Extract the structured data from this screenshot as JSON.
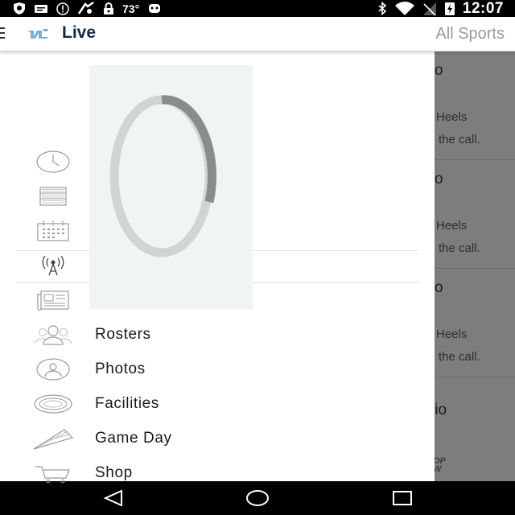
{
  "status_bar": {
    "temperature": "73°",
    "time": "12:07",
    "icons": [
      "shield-icon",
      "message-icon",
      "alert-circle-icon",
      "fan-icon",
      "lock-icon",
      "temperature",
      "android-icon",
      "bluetooth-icon",
      "wifi-icon",
      "signal-icon",
      "battery-icon",
      "time"
    ]
  },
  "app_bar": {
    "title": "Live",
    "right_label": "All Sports",
    "logo_icon": "unc-logo-icon",
    "brand_color": "#13294b"
  },
  "drawer": {
    "items": [
      {
        "icon": "clock-icon",
        "label": ""
      },
      {
        "icon": "list-icon",
        "label": ""
      },
      {
        "icon": "calendar-icon",
        "label": ""
      },
      {
        "icon": "broadcast-icon",
        "label": ""
      },
      {
        "icon": "news-icon",
        "label": ""
      },
      {
        "icon": "rosters-icon",
        "label": "Rosters"
      },
      {
        "icon": "photos-icon",
        "label": "Photos"
      },
      {
        "icon": "facilities-icon",
        "label": "Facilities"
      },
      {
        "icon": "gameday-icon",
        "label": "Game Day"
      },
      {
        "icon": "shop-icon",
        "label": "Shop"
      }
    ]
  },
  "loading_indicator": {
    "icon": "loading-spinner-icon"
  },
  "background_feed": {
    "cards": [
      {
        "title": "o",
        "line1": "Heels",
        "line2": "the call."
      },
      {
        "title": "o",
        "line1": "Heels",
        "line2": "the call."
      },
      {
        "title": "o",
        "line1": "Heels",
        "line2": "the call."
      }
    ],
    "partial_title": "lio",
    "partial_logo_line1": "OP",
    "partial_logo_line2": "W"
  },
  "nav_bar": {
    "icons": [
      "back-icon",
      "home-icon",
      "recents-icon"
    ]
  }
}
